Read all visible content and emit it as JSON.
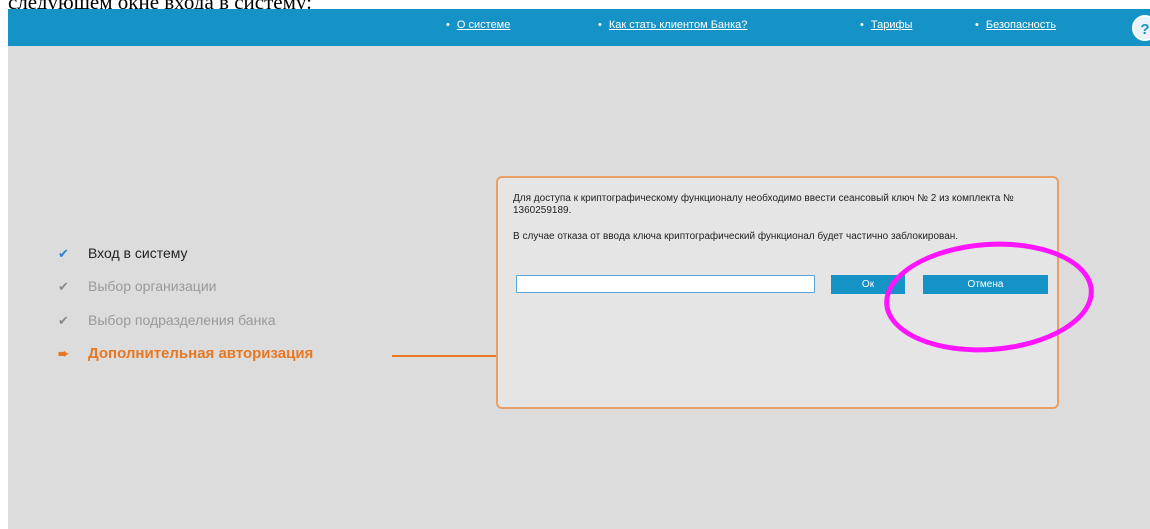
{
  "document": {
    "caption_fragment": "следующем окне входа в систему:"
  },
  "topnav": {
    "bullet": "•",
    "links": [
      {
        "label": "О системе"
      },
      {
        "label": "Как стать клиентом Банка?"
      },
      {
        "label": "Тарифы"
      },
      {
        "label": "Безопасность"
      }
    ],
    "help_glyph": "?"
  },
  "steps": [
    {
      "label": "Вход в систему",
      "state": "done",
      "icon": "checkmark-icon",
      "mark": "✔"
    },
    {
      "label": "Выбор организации",
      "state": "done",
      "icon": "checkmark-icon",
      "mark": "✔"
    },
    {
      "label": "Выбор подразделения банка",
      "state": "done",
      "icon": "checkmark-icon",
      "mark": "✔"
    },
    {
      "label": "Дополнительная авторизация",
      "state": "current",
      "icon": "arrow-right-icon",
      "mark": "➨"
    }
  ],
  "dialog": {
    "paragraph1": "Для доступа к криптографическому функционалу необходимо ввести сеансовый ключ № 2 из комплекта № 1360259189.",
    "paragraph2": "В случае отказа от ввода ключа криптографический функционал будет частично заблокирован.",
    "key_value": "",
    "ok_label": "Ок",
    "cancel_label": "Отмена"
  },
  "colors": {
    "topbar": "#1592c6",
    "accent": "#e87722",
    "highlight": "#ff14ff",
    "background": "#dcdcdc"
  }
}
